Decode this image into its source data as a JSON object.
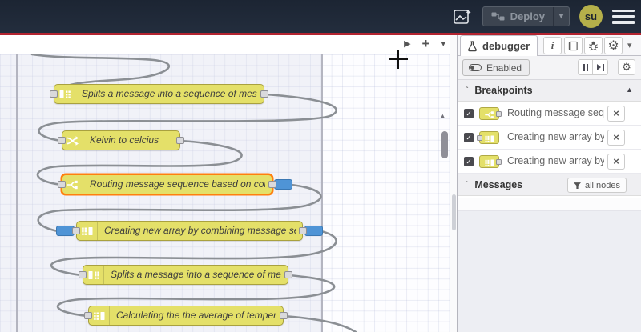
{
  "header": {
    "deploy_label": "Deploy",
    "avatar_text": "su"
  },
  "canvas": {
    "nodes": [
      {
        "label": "Splits a message into a sequence of messages.",
        "icon": "split-icon"
      },
      {
        "label": "Kelvin to celcius",
        "icon": "change-icon"
      },
      {
        "label": "Routing message sequence based on condition",
        "icon": "switch-icon",
        "selected": true,
        "breakpoint_output": true
      },
      {
        "label": "Creating new array by combining message sequence",
        "icon": "join-icon",
        "breakpoint_input": true,
        "breakpoint_output": true
      },
      {
        "label": "Splits a message into a sequence of messages.",
        "icon": "split-icon"
      },
      {
        "label": "Calculating the the average of temperature",
        "icon": "join-icon"
      }
    ],
    "toolbar_icons": [
      "play-icon",
      "plus-icon",
      "chevron-down-icon"
    ]
  },
  "sidebar": {
    "tab_label": "debugger",
    "tab_icon": "flask-icon",
    "header_icons": [
      "info-icon",
      "book-icon",
      "bug-icon",
      "gear-icon",
      "chevron-down-icon"
    ],
    "toolbar": {
      "enabled_label": "Enabled",
      "icons": [
        "pause-icon",
        "step-icon",
        "gear-icon"
      ]
    },
    "breakpoints": {
      "title": "Breakpoints",
      "items": [
        {
          "checked": true,
          "node_icon": "switch-icon",
          "port_side": "right",
          "label": "Routing message sequence based on condition"
        },
        {
          "checked": true,
          "node_icon": "join-icon",
          "port_side": "left",
          "label": "Creating new array by combining message sequence"
        },
        {
          "checked": true,
          "node_icon": "join-icon",
          "port_side": "right",
          "label": "Creating new array by combining message sequence"
        }
      ]
    },
    "messages": {
      "title": "Messages",
      "filter_label": "all nodes",
      "filter_icon": "funnel-icon"
    }
  },
  "colors": {
    "header_bg": "#202a39",
    "deploy_red_line": "#b32430",
    "node_yellow": "#e4e069",
    "node_border": "#a9a13f",
    "selected_orange": "#ff7f0e",
    "breakpoint_blue": "#4f94d6",
    "wire_gray": "#8b8f94",
    "avatar_olive": "#b5b04a"
  }
}
